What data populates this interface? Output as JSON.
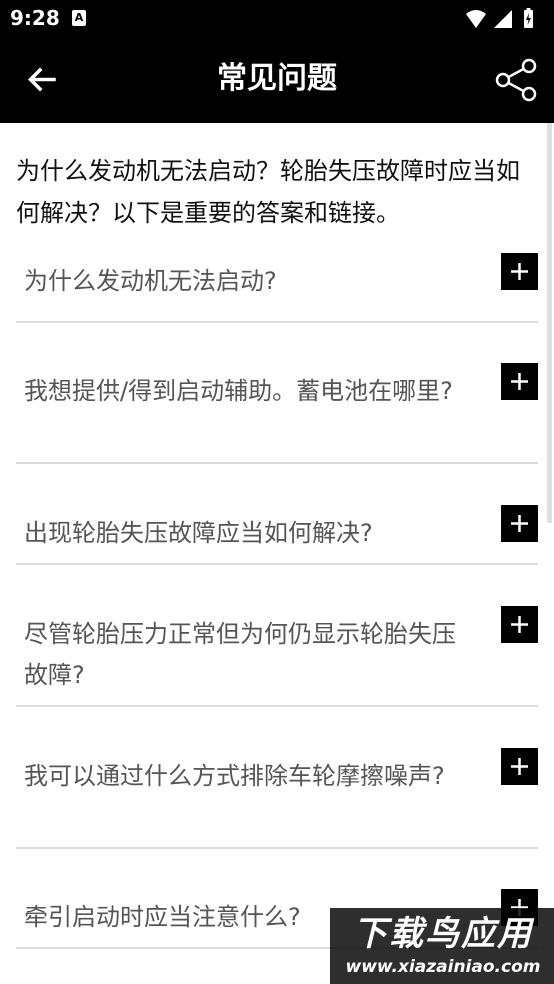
{
  "status_bar": {
    "time": "9:28",
    "notification_badge": "A",
    "icons": [
      "wifi-icon",
      "signal-icon",
      "battery-icon"
    ]
  },
  "app_bar": {
    "title": "常见问题",
    "back_icon": "arrow-left-icon",
    "share_icon": "share-icon"
  },
  "intro": "为什么发动机无法启动？轮胎失压故障时应当如何解决？以下是重要的答案和链接。",
  "faq": [
    {
      "question": "为什么发动机无法启动?"
    },
    {
      "question": "我想提供/得到启动辅助。蓄电池在哪里?"
    },
    {
      "question": "出现轮胎失压故障应当如何解决?"
    },
    {
      "question": "尽管轮胎压力正常但为何仍显示轮胎失压故障?"
    },
    {
      "question": "我可以通过什么方式排除车轮摩擦噪声?"
    },
    {
      "question": "牵引启动时应当注意什么?"
    }
  ],
  "watermark": {
    "title": "下载鸟应用",
    "url": "www.xiazainiao.com"
  },
  "colors": {
    "bar_background": "#000000",
    "bar_text": "#ffffff",
    "question_text": "#555555",
    "divider": "#dcdcdc"
  }
}
